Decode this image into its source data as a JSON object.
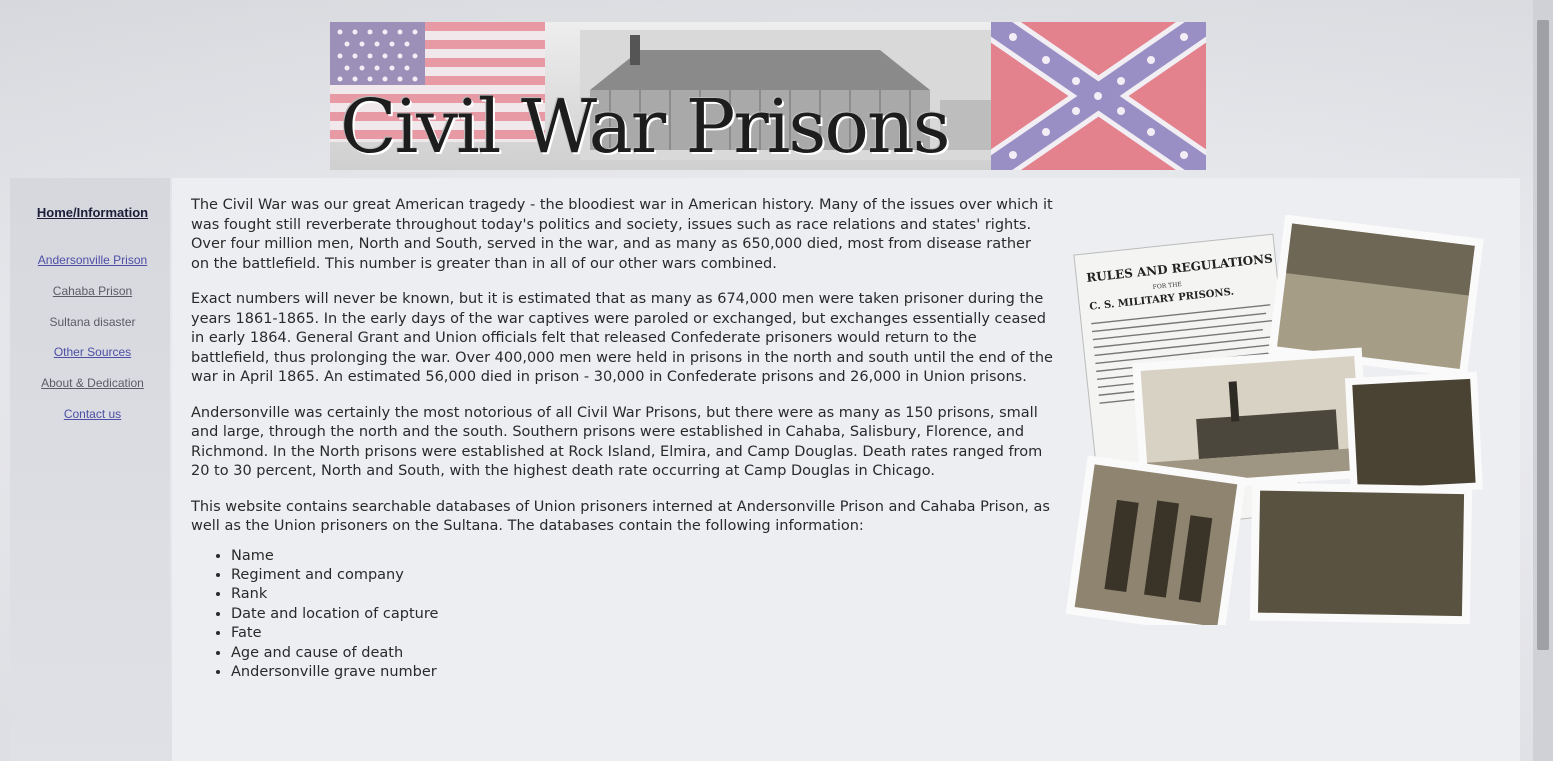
{
  "banner": {
    "title": "Civil War Prisons"
  },
  "nav": {
    "items": [
      {
        "label": "Home/Information"
      },
      {
        "label": "Andersonville Prison"
      },
      {
        "label": "Cahaba Prison"
      },
      {
        "label": "Sultana disaster"
      },
      {
        "label": "Other Sources"
      },
      {
        "label": "About & Dedication"
      },
      {
        "label": "Contact us"
      }
    ]
  },
  "content": {
    "paragraphs": [
      "The Civil War was our great American tragedy - the bloodiest war in American history. Many of the issues over which it was fought still reverberate throughout today's politics and society, issues such as race relations and states' rights. Over four million men, North and South, served in the war, and as many as 650,000 died, most from disease rather on the battlefield. This number is greater than in all of our other wars combined.",
      "Exact numbers will never be known, but it is estimated that as many as 674,000 men were taken prisoner during the years 1861-1865. In the early days of the war captives were paroled or exchanged, but exchanges essentially ceased in early 1864. General Grant and Union officials felt that released Confederate prisoners would return to the battlefield, thus prolonging the war. Over 400,000 men were held in prisons in the north and south until the end of the war in April 1865. An estimated 56,000 died in prison - 30,000 in Confederate prisons and 26,000 in Union prisons.",
      "Andersonville was certainly the most notorious of all Civil War Prisons, but there were as many as 150 prisons, small and large, through the north and the south. Southern prisons were established in Cahaba, Salisbury, Florence, and Richmond. In the North prisons were established at Rock Island, Elmira, and Camp Douglas. Death rates ranged from 20 to 30 percent, North and South, with the highest death rate occurring at Camp Douglas in Chicago.",
      "This website contains searchable databases of Union prisoners interned at Andersonville Prison and Cahaba Prison, as well as the Union prisoners on the Sultana. The databases contain the following information:"
    ],
    "list": [
      "Name",
      "Regiment and company",
      "Rank",
      "Date and location of capture",
      "Fate",
      "Age and cause of death",
      "Andersonville grave number"
    ]
  },
  "collage": {
    "doc_title_line1": "RULES AND REGULATIONS",
    "doc_title_line2": "FOR THE",
    "doc_title_line3": "C. S. MILITARY PRISONS."
  },
  "colors": {
    "link": "#4d4fa6",
    "text": "#2a2a2a",
    "background": "#e6e7ec"
  }
}
